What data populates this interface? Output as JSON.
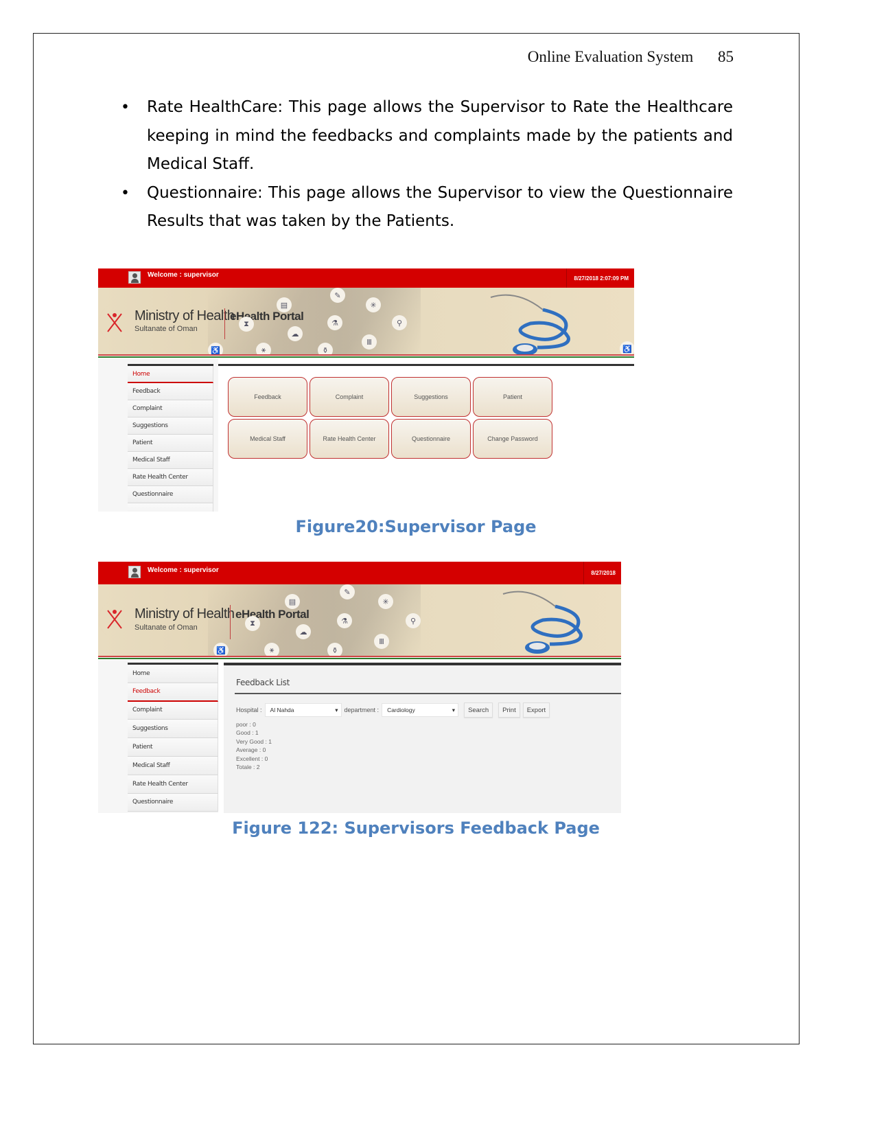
{
  "header": {
    "title": "Online Evaluation System",
    "page_number": "85"
  },
  "bullets": [
    "Rate HealthCare: This page allows the Supervisor to Rate the Healthcare keeping in mind the feedbacks and complaints made by the patients and Medical Staff.",
    "Questionnaire: This page allows the Supervisor to view the Questionnaire Results that was taken by the Patients."
  ],
  "portal": {
    "welcome": "Welcome : supervisor",
    "ministry": "Ministry of Health",
    "country": "Sultanate of Oman",
    "portal_name": "eHealth Portal"
  },
  "figure1": {
    "datetime": "8/27/2018 2:07:09 PM",
    "menu": [
      "Home",
      "Feedback",
      "Complaint",
      "Suggestions",
      "Patient",
      "Medical Staff",
      "Rate Health Center",
      "Questionnaire"
    ],
    "active_menu": "Home",
    "tiles": [
      "Feedback",
      "Complaint",
      "Suggestions",
      "Patient",
      "Medical Staff",
      "Rate Health Center",
      "Questionnaire",
      "Change Password"
    ],
    "caption": "Figure20:Supervisor Page"
  },
  "figure2": {
    "datetime": "8/27/2018",
    "menu": [
      "Home",
      "Feedback",
      "Complaint",
      "Suggestions",
      "Patient",
      "Medical Staff",
      "Rate Health Center",
      "Questionnaire"
    ],
    "active_menu": "Feedback",
    "list_title": "Feedback List",
    "hospital_label": "Hospital :",
    "hospital_value": "Al Nahda",
    "department_label": "department :",
    "department_value": "Cardiology",
    "buttons": {
      "search": "Search",
      "print": "Print",
      "export": "Export"
    },
    "stats": [
      "poor : 0",
      "Good : 1",
      "Very Good : 1",
      "Average : 0",
      "Excellent : 0",
      "Totale : 2"
    ],
    "caption": "Figure 122: Supervisors Feedback Page"
  },
  "colors": {
    "brand_red": "#d40000",
    "caption_blue": "#4f81bd"
  }
}
